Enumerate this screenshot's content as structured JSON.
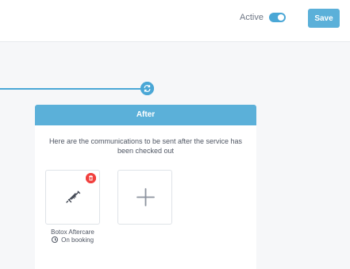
{
  "header": {
    "active_label": "Active",
    "active_on": true,
    "save_label": "Save"
  },
  "after_section": {
    "title": "After",
    "description": "Here are the communications to be sent after the service has been checked out"
  },
  "communications": [
    {
      "title": "Botox Aftercare",
      "trigger": "On booking",
      "icon": "syringe-icon"
    }
  ],
  "icons": {
    "flow_node": "sync-icon",
    "add": "plus-icon",
    "delete": "trash-icon",
    "clock": "clock-icon"
  },
  "colors": {
    "accent": "#5bb0d9",
    "toggle": "#4aa7d6",
    "delete": "#f1403e"
  }
}
